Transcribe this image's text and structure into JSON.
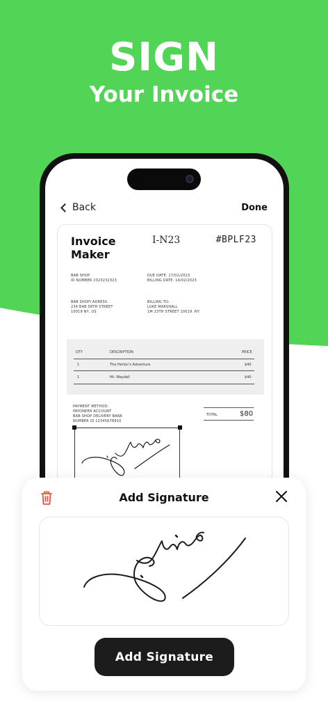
{
  "hero": {
    "headline": "SIGN",
    "subhead": "Your Invoice"
  },
  "colors": {
    "brand_green": "#52d456",
    "dark_button": "#1c1c1c",
    "trash_red": "#e8503a"
  },
  "nav": {
    "back_label": "Back",
    "done_label": "Done",
    "back_icon": "chevron-left-icon"
  },
  "invoice": {
    "title": "Invoice Maker",
    "number": "I-N23",
    "code": "#BPLF23",
    "from_name": "BAB SHOP",
    "from_id": "ID NUMBER 2323232323",
    "due_date": "DUE DATE: 17/02/2023",
    "billing_date": "BILLING DATE: 14/02/2023",
    "from_address_label": "BAB SHOPI ADRESS",
    "from_address_1": "234 BAB 58TH STREET",
    "from_address_2": "10019 NY, US",
    "billing_to_label": "BILLING TO:",
    "billing_to_name": "LUKE MARSHALL",
    "billing_to_address": "1M 23TH STREET 10019. NY.",
    "table": {
      "headers": [
        "QTY",
        "DESCRIPTION",
        "PRICE"
      ],
      "rows": [
        {
          "qty": "1",
          "description": "The Herloc's Adventure",
          "price": "$40"
        },
        {
          "qty": "1",
          "description": "Mr. Waydall",
          "price": "$40"
        }
      ]
    },
    "payment_label": "PAYMENT METHOD:",
    "payment_1": "PAYONEER ACCOUNT",
    "payment_2": "BAB SHOP DELIVERY BANK",
    "payment_3": "NUMBER ID 12345678910",
    "total_label": "TOTAL",
    "total_value": "$80"
  },
  "sheet": {
    "title": "Add Signature",
    "delete_icon": "trash-icon",
    "close_icon": "close-icon",
    "button_label": "Add Signature"
  }
}
